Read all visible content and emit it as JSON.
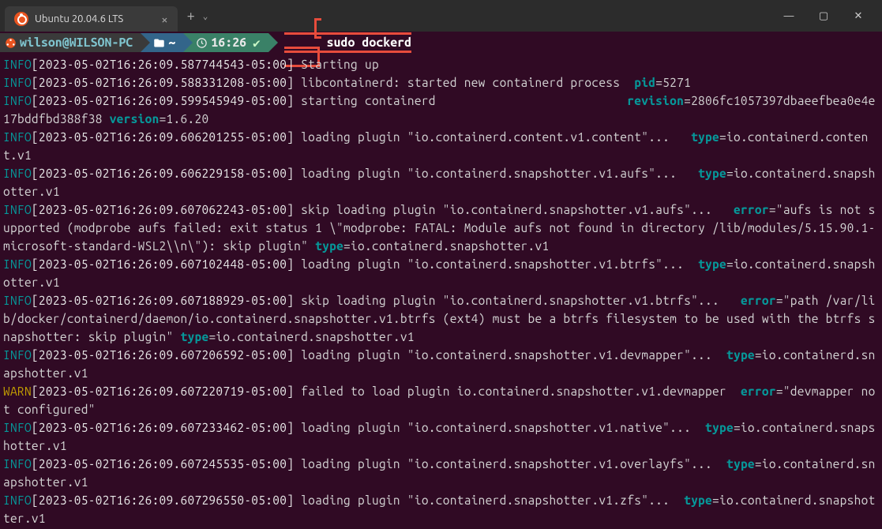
{
  "tab": {
    "title": "Ubuntu 20.04.6 LTS"
  },
  "prompt": {
    "user": "wilson@WILSON-PC",
    "home": "~",
    "time": "16:26",
    "check": "✔",
    "command": "sudo dockerd"
  },
  "lines": [
    {
      "lvl": "INFO",
      "ts": "[2023-05-02T16:26:09.587744543-05:00]",
      "msg": " Starting up"
    },
    {
      "lvl": "INFO",
      "ts": "[2023-05-02T16:26:09.588331208-05:00]",
      "msg": " libcontainerd: started new containerd process  ",
      "k": "pid",
      "v": "=5271"
    },
    {
      "lvl": "INFO",
      "ts": "[2023-05-02T16:26:09.599545949-05:00]",
      "msg": " starting containerd                           ",
      "k": "revision",
      "v": "=2806fc1057397dbaeefbea0e4e17bddfbd388f38 ",
      "k2": "version",
      "v2": "=1.6.20"
    },
    {
      "lvl": "INFO",
      "ts": "[2023-05-02T16:26:09.606201255-05:00]",
      "msg": " loading plugin \"io.containerd.content.v1.content\"...   ",
      "k": "type",
      "v": "=io.containerd.content.v1"
    },
    {
      "lvl": "INFO",
      "ts": "[2023-05-02T16:26:09.606229158-05:00]",
      "msg": " loading plugin \"io.containerd.snapshotter.v1.aufs\"...   ",
      "k": "type",
      "v": "=io.containerd.snapshotter.v1"
    },
    {
      "lvl": "INFO",
      "ts": "[2023-05-02T16:26:09.607062243-05:00]",
      "msg": " skip loading plugin \"io.containerd.snapshotter.v1.aufs\"...   ",
      "k": "error",
      "v": "=\"aufs is not supported (modprobe aufs failed: exit status 1 \\\"modprobe: FATAL: Module aufs not found in directory /lib/modules/5.15.90.1-microsoft-standard-WSL2\\\\n\\\"): skip plugin\" ",
      "k2": "type",
      "v2": "=io.containerd.snapshotter.v1"
    },
    {
      "lvl": "INFO",
      "ts": "[2023-05-02T16:26:09.607102448-05:00]",
      "msg": " loading plugin \"io.containerd.snapshotter.v1.btrfs\"...  ",
      "k": "type",
      "v": "=io.containerd.snapshotter.v1"
    },
    {
      "lvl": "INFO",
      "ts": "[2023-05-02T16:26:09.607188929-05:00]",
      "msg": " skip loading plugin \"io.containerd.snapshotter.v1.btrfs\"...   ",
      "k": "error",
      "v": "=\"path /var/lib/docker/containerd/daemon/io.containerd.snapshotter.v1.btrfs (ext4) must be a btrfs filesystem to be used with the btrfs snapshotter: skip plugin\" ",
      "k2": "type",
      "v2": "=io.containerd.snapshotter.v1"
    },
    {
      "lvl": "INFO",
      "ts": "[2023-05-02T16:26:09.607206592-05:00]",
      "msg": " loading plugin \"io.containerd.snapshotter.v1.devmapper\"...  ",
      "k": "type",
      "v": "=io.containerd.snapshotter.v1"
    },
    {
      "lvl": "WARN",
      "ts": "[2023-05-02T16:26:09.607220719-05:00]",
      "msg": " failed to load plugin io.containerd.snapshotter.v1.devmapper  ",
      "k": "error",
      "v": "=\"devmapper not configured\""
    },
    {
      "lvl": "INFO",
      "ts": "[2023-05-02T16:26:09.607233462-05:00]",
      "msg": " loading plugin \"io.containerd.snapshotter.v1.native\"...  ",
      "k": "type",
      "v": "=io.containerd.snapshotter.v1"
    },
    {
      "lvl": "INFO",
      "ts": "[2023-05-02T16:26:09.607245535-05:00]",
      "msg": " loading plugin \"io.containerd.snapshotter.v1.overlayfs\"...  ",
      "k": "type",
      "v": "=io.containerd.snapshotter.v1"
    },
    {
      "lvl": "INFO",
      "ts": "[2023-05-02T16:26:09.607296550-05:00]",
      "msg": " loading plugin \"io.containerd.snapshotter.v1.zfs\"...  ",
      "k": "type",
      "v": "=io.containerd.snapshotter.v1"
    }
  ]
}
